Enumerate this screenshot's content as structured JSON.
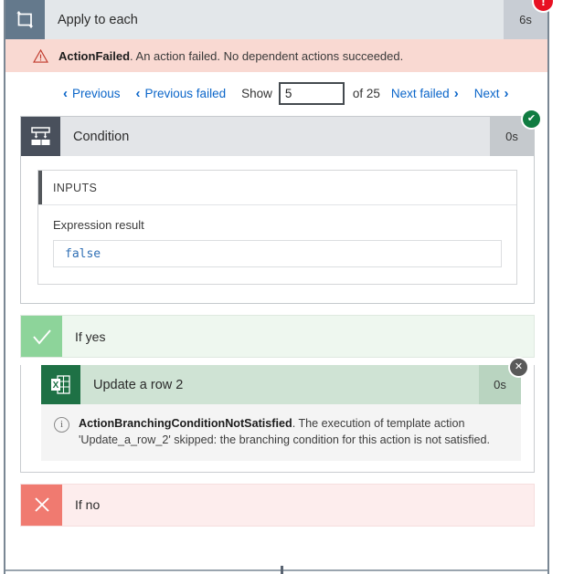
{
  "scope": {
    "title": "Apply to each",
    "duration": "6s",
    "icon": "foreach-loop-icon",
    "status_badge": "!",
    "status_badge_name": "error-badge-icon"
  },
  "error_banner": {
    "icon": "warning-triangle-icon",
    "code": "ActionFailed",
    "message": ". An action failed. No dependent actions succeeded."
  },
  "pager": {
    "previous": "Previous",
    "previous_failed": "Previous failed",
    "show_label": "Show",
    "current_value": "5",
    "placeholder": "",
    "total": "of 25",
    "next_failed": "Next failed",
    "next": "Next",
    "chevron_left": "‹",
    "chevron_right": "›",
    "link_color": "#0a65c9"
  },
  "condition": {
    "title": "Condition",
    "duration": "0s",
    "icon": "condition-branch-icon",
    "status_badge": "✔",
    "status_badge_name": "success-check-badge",
    "inputs": {
      "section_title": "INPUTS",
      "field_label": "Expression result",
      "value": "false",
      "value_color": "#2f6fb5"
    }
  },
  "branches": {
    "yes": {
      "label": "If yes",
      "icon": "checkmark-icon",
      "icon_bg": "#8dd49a",
      "action": {
        "title": "Update a row 2",
        "duration": "0s",
        "icon": "excel-icon",
        "status_badge": "✕",
        "status_badge_name": "skipped-badge-icon",
        "note_icon": "info-icon",
        "note_code": "ActionBranchingConditionNotSatisfied",
        "note_message": ". The execution of template action 'Update_a_row_2' skipped: the branching condition for this action is not satisfied."
      }
    },
    "no": {
      "label": "If no",
      "icon": "cross-icon",
      "icon_bg": "#f07a70"
    }
  }
}
